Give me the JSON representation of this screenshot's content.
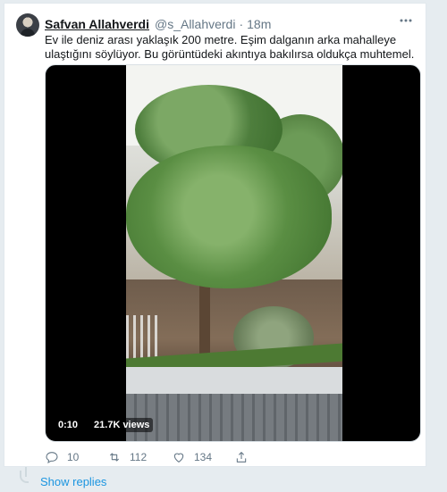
{
  "tweet": {
    "author_name": "Safvan Allahverdi",
    "handle": "@s_Allahverdi",
    "separator": "·",
    "time": "18m",
    "text": "Ev ile deniz arası yaklaşık 200 metre. Eşim dalganın arka mahalleye ulaştığını söylüyor. Bu görüntüdeki akıntıya bakılırsa oldukça muhtemel."
  },
  "video": {
    "duration": "0:10",
    "views": "21.7K views"
  },
  "actions": {
    "reply_count": "10",
    "retweet_count": "112",
    "like_count": "134"
  },
  "show_replies_label": "Show replies",
  "colors": {
    "link_blue": "#1b95e0",
    "secondary_text": "#657786",
    "background": "#e6ecf0"
  },
  "icons": [
    "avatar",
    "more-dots-icon",
    "reply-icon",
    "retweet-icon",
    "like-icon",
    "share-icon"
  ]
}
